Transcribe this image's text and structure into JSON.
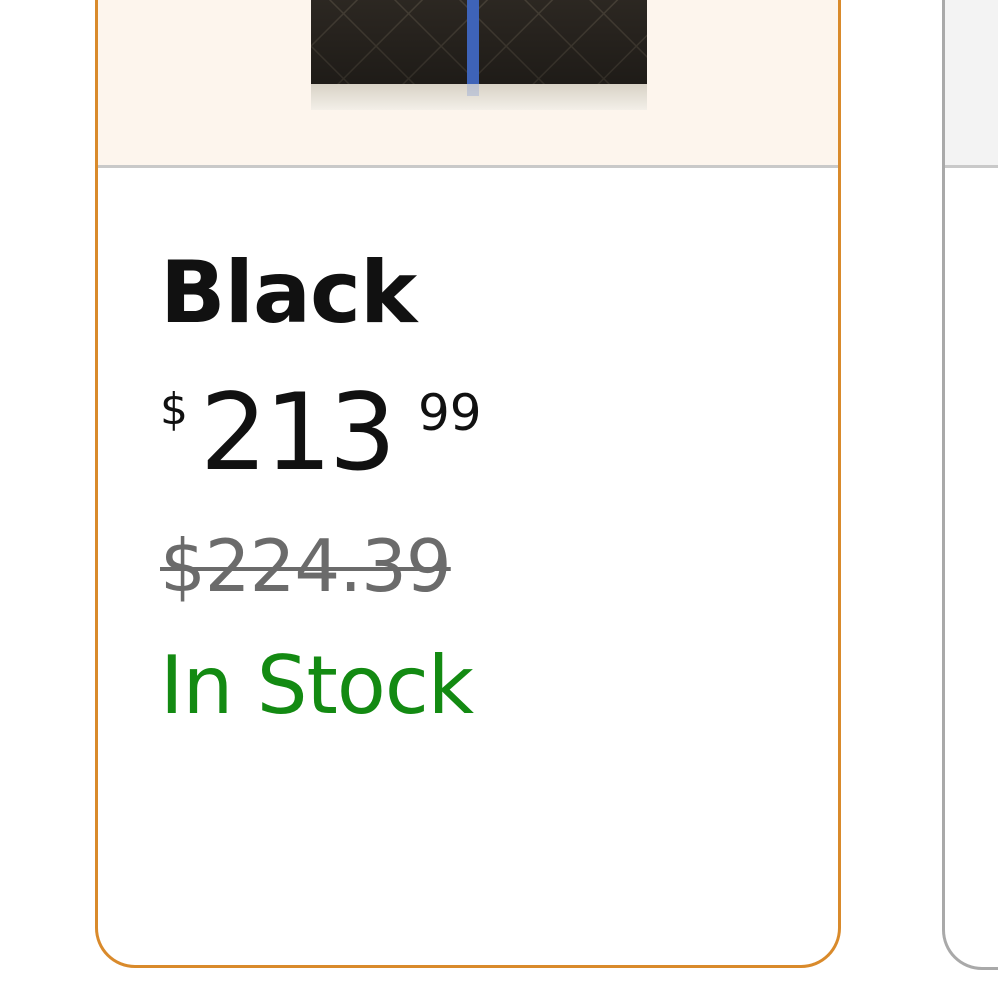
{
  "swatch": {
    "color_name": "Black",
    "price": {
      "symbol": "$",
      "whole": "213",
      "fraction": "99"
    },
    "list_price": "$224.39",
    "availability": "In Stock",
    "selected": true,
    "image_icon": "product-thumbnail-icon",
    "colors": {
      "border": "#d98a2b",
      "image_background": "#fdf5ed",
      "availability": "#138a12",
      "list_price": "#6b6b6b"
    }
  },
  "next_swatch": {
    "selected": false,
    "colors": {
      "border": "#a9a9a9",
      "image_background": "#f3f3f3"
    }
  }
}
